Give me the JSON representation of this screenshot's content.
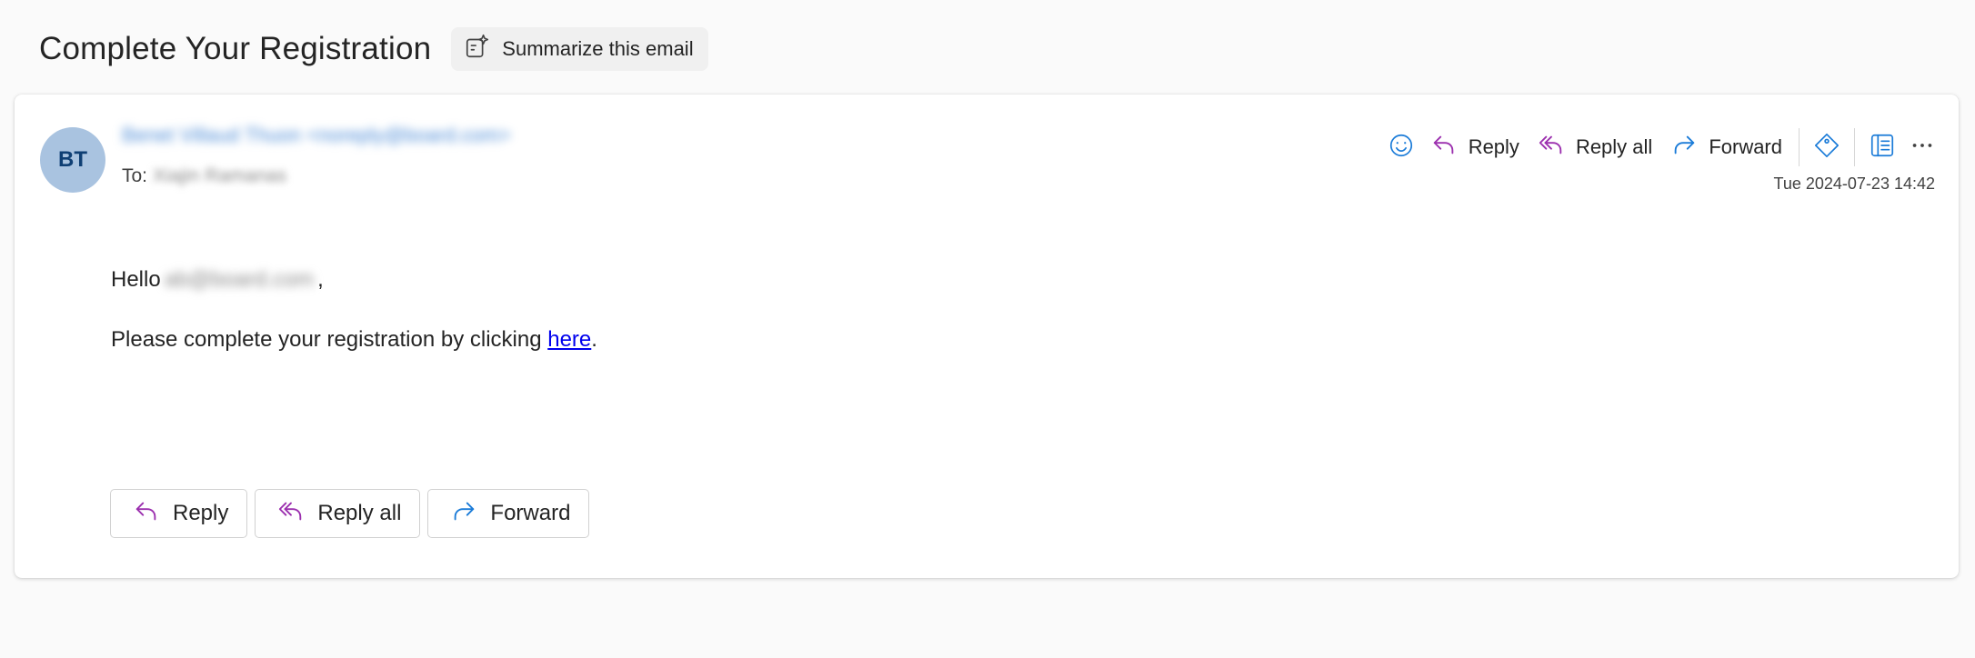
{
  "subject": "Complete Your Registration",
  "summarize": {
    "label": "Summarize this email",
    "icon": "summarize-sparkle-icon"
  },
  "sender": {
    "initials": "BT",
    "display": "Benet Villaud Thuon <noreply@board.com>"
  },
  "to": {
    "label": "To:",
    "recipient": "Xiajin Ramanas"
  },
  "actions": {
    "emoji_icon": "emoji-icon",
    "reply": "Reply",
    "reply_all": "Reply all",
    "forward": "Forward"
  },
  "date": "Tue 2024-07-23 14:42",
  "body": {
    "greeting": "Hello",
    "greeting_name": "ab@board.com",
    "greeting_punct": ",",
    "line_prefix": "Please complete your registration by clicking ",
    "link": "here",
    "line_suffix": "."
  },
  "bottom_actions": {
    "reply": "Reply",
    "reply_all": "Reply all",
    "forward": "Forward"
  },
  "colors": {
    "reply_accent": "#9b2fae",
    "forward_accent": "#1a7bd8",
    "avatar_bg": "#a9c3e0",
    "avatar_text": "#0f3f74",
    "link": "#0000ee"
  }
}
